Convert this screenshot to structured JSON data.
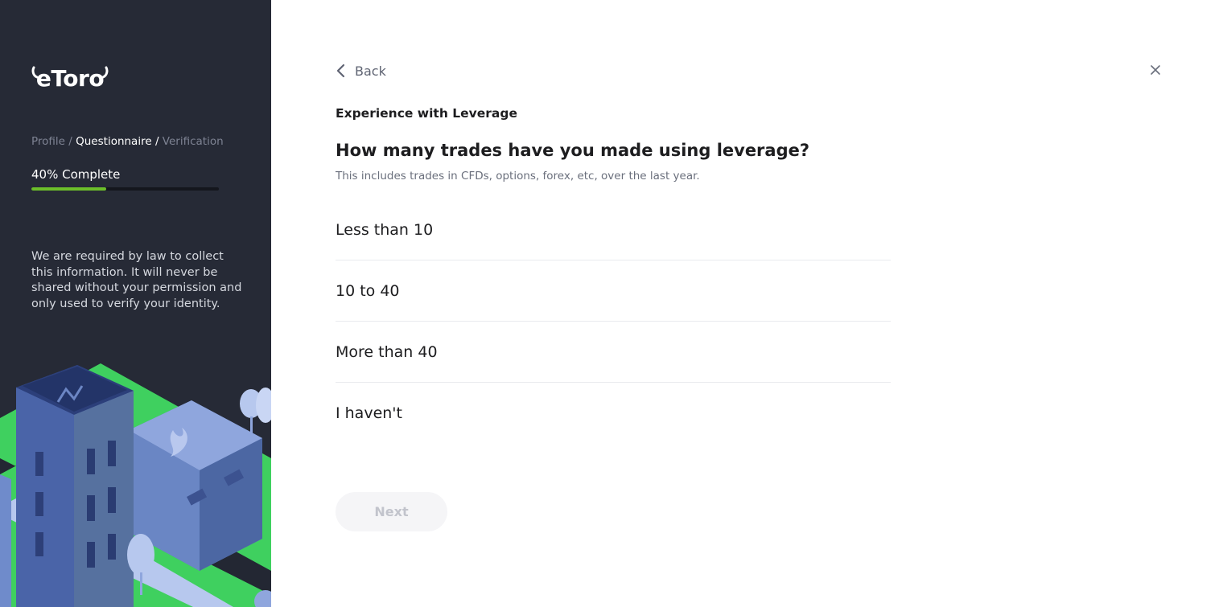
{
  "brand": {
    "logo_text": "etoro",
    "colors": {
      "sidebar_bg": "#262a36",
      "progress": "#6cbf2a",
      "accent_green": "#3fd05f"
    }
  },
  "sidebar": {
    "steps": [
      {
        "label": "Profile",
        "state": "done"
      },
      {
        "label": "Questionnaire",
        "state": "current"
      },
      {
        "label": "Verification",
        "state": "pending"
      }
    ],
    "separator": " / ",
    "progress_label": "40% Complete",
    "progress_fraction": 0.4,
    "legal_text": "We are required by law to collect this information. It will never be shared without your permission and only used to verify your identity."
  },
  "header": {
    "back_label": "Back",
    "back_icon": "chevron-left-icon",
    "close_icon": "close-icon"
  },
  "main": {
    "section_title": "Experience with Leverage",
    "question": "How many trades have you made using leverage?",
    "hint": "This includes trades in CFDs, options, forex, etc, over the last year.",
    "options": [
      {
        "label": "Less than 10"
      },
      {
        "label": "10 to 40"
      },
      {
        "label": "More than 40"
      },
      {
        "label": "I haven't"
      }
    ],
    "next_label": "Next",
    "next_enabled": false
  }
}
